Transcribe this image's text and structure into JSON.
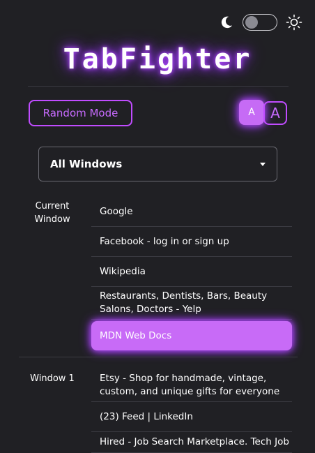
{
  "header": {
    "title": "TabFighter",
    "theme_toggle": {
      "icons": [
        "moon-icon",
        "sun-icon"
      ],
      "state": "dark"
    }
  },
  "controls": {
    "random_mode_label": "Random Mode",
    "font_small_label": "A",
    "font_large_label": "A"
  },
  "window_select": {
    "selected": "All Windows"
  },
  "groups": [
    {
      "label": "Current Window",
      "tabs": [
        "Google",
        "Facebook - log in or sign up",
        "Wikipedia",
        "Restaurants, Dentists, Bars, Beauty Salons, Doctors - Yelp",
        "MDN Web Docs"
      ],
      "active_index": 4
    },
    {
      "label": "Window 1",
      "tabs": [
        "Etsy - Shop for handmade, vintage, custom, and unique gifts for everyone",
        "(23) Feed | LinkedIn",
        "Hired - Job Search Marketplace. Tech Job"
      ]
    }
  ],
  "colors": {
    "accent": "#c04cff",
    "active_tab": "#c86bf7",
    "background": "#202024"
  }
}
